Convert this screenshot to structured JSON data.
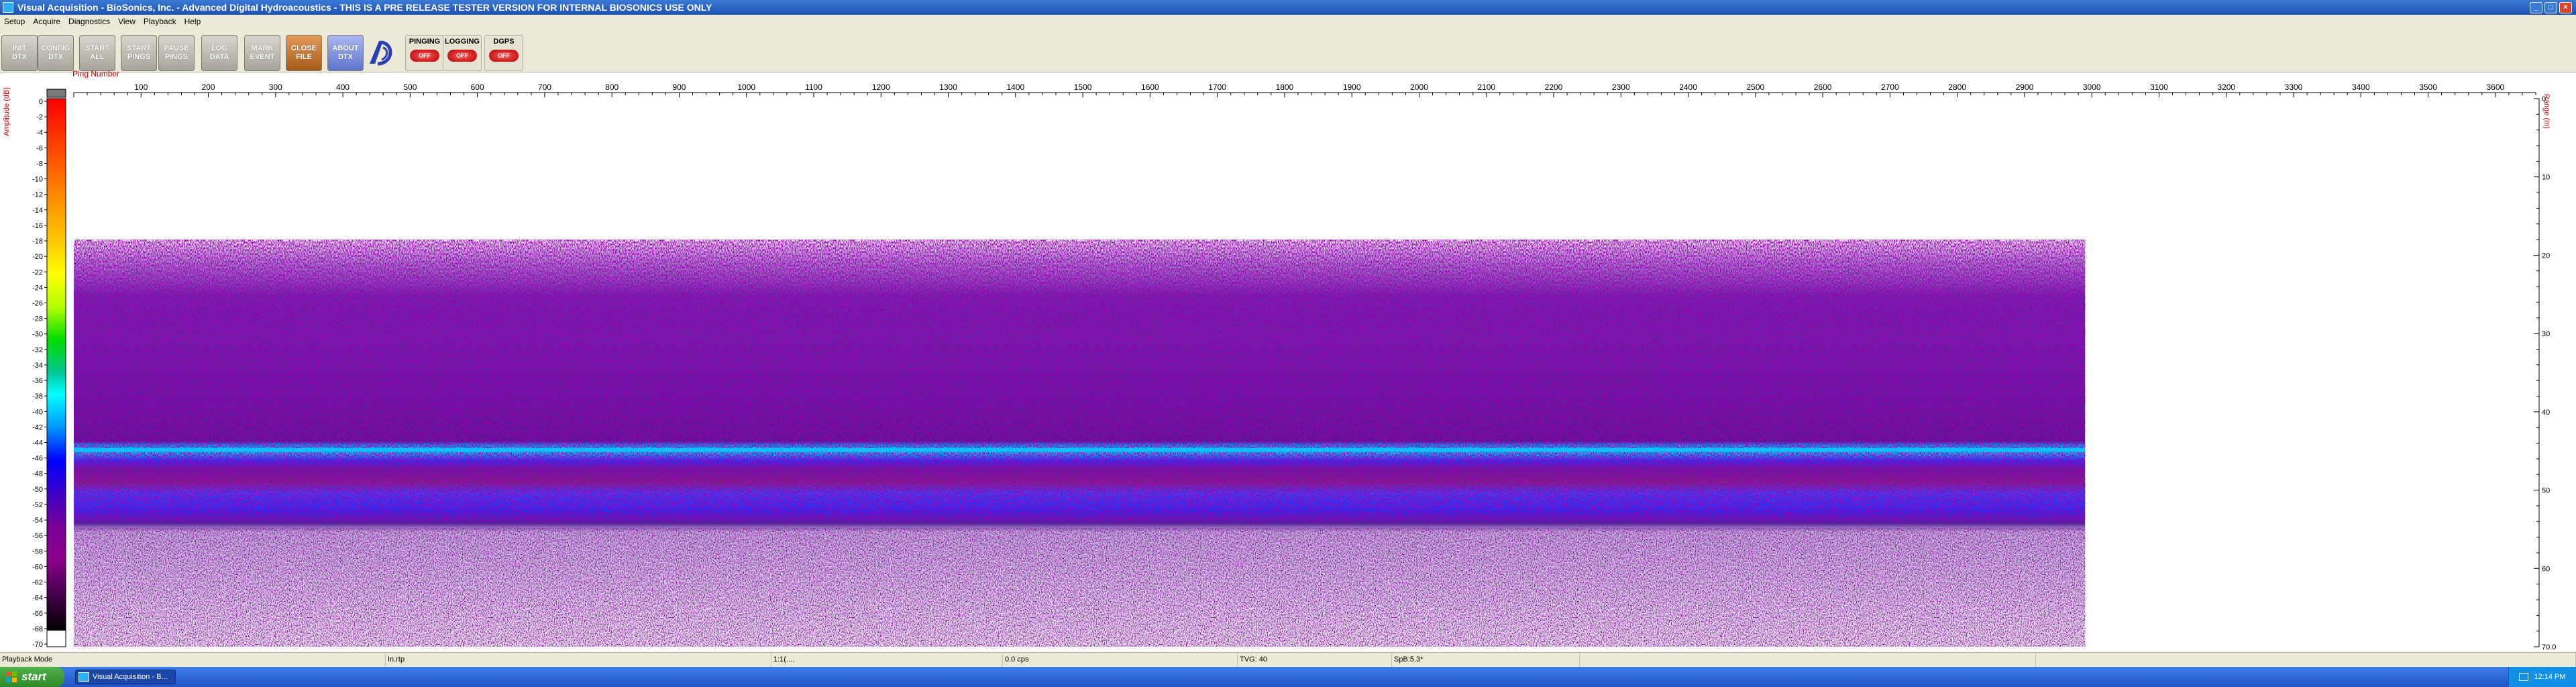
{
  "window": {
    "title": "Visual Acquisition  -  BioSonics, Inc.  -  Advanced Digital Hydroacoustics  -  THIS IS A PRE RELEASE TESTER VERSION FOR INTERNAL BIOSONICS USE ONLY"
  },
  "menu": [
    "Setup",
    "Acquire",
    "Diagnostics",
    "View",
    "Playback",
    "Help"
  ],
  "toolbar": {
    "buttons": [
      {
        "line1": "INIT",
        "line2": "DTX"
      },
      {
        "line1": "CONFIG",
        "line2": "DTX"
      },
      {
        "line1": "START",
        "line2": "ALL"
      },
      {
        "line1": "START",
        "line2": "PINGS"
      },
      {
        "line1": "PAUSE",
        "line2": "PINGS"
      },
      {
        "line1": "LOG",
        "line2": "DATA"
      },
      {
        "line1": "MARK",
        "line2": "EVENT"
      },
      {
        "line1": "CLOSE",
        "line2": "FILE"
      },
      {
        "line1": "ABOUT",
        "line2": "DTX"
      }
    ],
    "indicators": [
      {
        "label": "PINGING",
        "state": "OFF"
      },
      {
        "label": "LOGGING",
        "state": "OFF"
      },
      {
        "label": "DGPS",
        "state": "OFF"
      }
    ]
  },
  "echogram": {
    "x_axis_label": "Ping Number",
    "x_ticks": [
      "100",
      "200",
      "300",
      "400",
      "500",
      "600",
      "700",
      "800",
      "900",
      "1000",
      "1100",
      "1200",
      "1300",
      "1400",
      "1500",
      "1600",
      "1700",
      "1800",
      "1900",
      "2000",
      "2100",
      "2200",
      "2300",
      "2400",
      "2500",
      "2600",
      "2700",
      "2800",
      "2900",
      "3000",
      "3100",
      "3200",
      "3300",
      "3400",
      "3500",
      "3600"
    ],
    "colorbar_label": "Amplitude (dB)",
    "colorbar_ticks": [
      "0",
      "-2",
      "-4",
      "-6",
      "-8",
      "-10",
      "-12",
      "-14",
      "-16",
      "-18",
      "-20",
      "-22",
      "-24",
      "-26",
      "-28",
      "-30",
      "-32",
      "-34",
      "-36",
      "-38",
      "-40",
      "-42",
      "-44",
      "-46",
      "-48",
      "-50",
      "-52",
      "-54",
      "-56",
      "-58",
      "-60",
      "-62",
      "-64",
      "-66",
      "-68",
      "-70"
    ],
    "range_label": "Range (m)",
    "range_ticks": [
      "0",
      "10",
      "20",
      "30",
      "40",
      "50",
      "60",
      "70.0"
    ],
    "colorbar_colors": [
      "#7a7a7a",
      "#ff0000",
      "#ff4d00",
      "#ff8c00",
      "#ffc800",
      "#ffff00",
      "#b4ff00",
      "#00dc00",
      "#00c896",
      "#00ffff",
      "#0096ff",
      "#0000ff",
      "#3c00c8",
      "#780096",
      "#8c008c",
      "#4b0050",
      "#000000",
      "#ffffff"
    ],
    "data_end_ping": 2990,
    "x_max_ping": 3660,
    "range_max_m": 70
  },
  "status": {
    "mode": "Playback Mode",
    "cells": [
      "In.rtp",
      "1:1(....",
      "0.0 cps",
      "TVG: 40",
      "SpB:5.3*"
    ]
  },
  "taskbar": {
    "start_label": "start",
    "task_label": "Visual Acquisition  -  B...",
    "clock": "12:14 PM"
  }
}
